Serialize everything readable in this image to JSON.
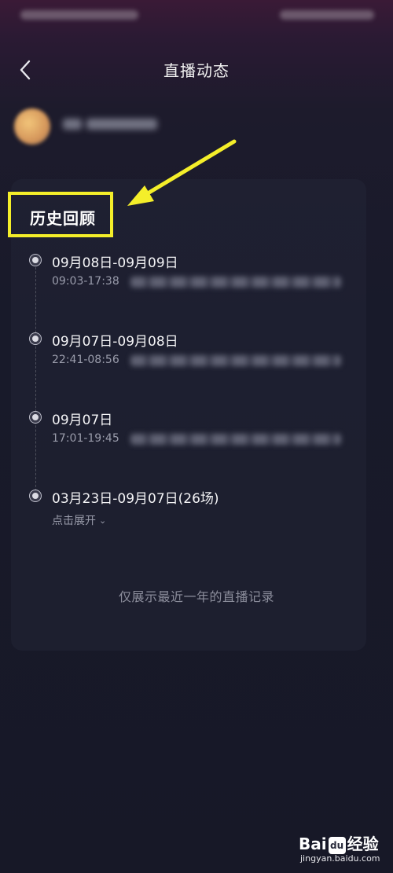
{
  "header": {
    "title": "直播动态"
  },
  "section": {
    "title": "历史回顾"
  },
  "timeline": [
    {
      "date": "09月08日-09月09日",
      "time": "09:03-17:38"
    },
    {
      "date": "09月07日-09月08日",
      "time": "22:41-08:56"
    },
    {
      "date": "09月07日",
      "time": "17:01-19:45"
    },
    {
      "date": "03月23日-09月07日(26场)",
      "expand_label": "点击展开"
    }
  ],
  "footer": {
    "note": "仅展示最近一年的直播记录"
  },
  "watermark": {
    "logo_a": "Bai",
    "logo_du": "du",
    "logo_b": "经验",
    "site": "jingyan.baidu.com"
  },
  "colors": {
    "highlight": "#f4ee2a",
    "arrow": "#f4ee2a"
  }
}
